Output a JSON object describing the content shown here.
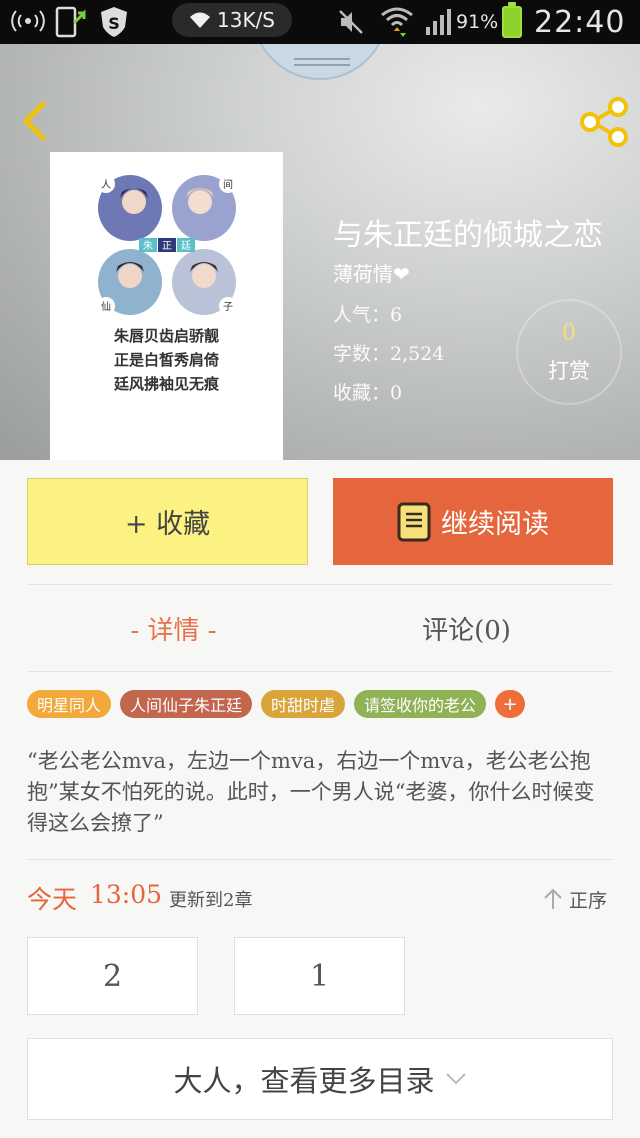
{
  "status_bar": {
    "speed": "13K/S",
    "battery_percent": "91%",
    "time": "22:40"
  },
  "book": {
    "title": "与朱正廷的倾城之恋",
    "author": "薄荷情❤",
    "popularity": "人气：6",
    "word_count": "字数：2,524",
    "favorites": "收藏：0",
    "tip_count": "0",
    "tip_label": "打赏",
    "cover_lines": [
      "朱唇贝齿启骄靓",
      "正是白皙秀肩倚",
      "廷风拂袖见无痕"
    ],
    "cover_corner_chars": [
      "人",
      "间",
      "仙",
      "子"
    ],
    "cover_center_chars": [
      "朱",
      "正",
      "廷"
    ]
  },
  "actions": {
    "favorite_label": "+ 收藏",
    "read_label": "继续阅读"
  },
  "tabs": {
    "detail": "- 详情 -",
    "comment": "评论(0)"
  },
  "tags": [
    {
      "label": "明星同人",
      "color": "#f2a83a"
    },
    {
      "label": "人间仙子朱正廷",
      "color": "#c2674e"
    },
    {
      "label": "时甜时虐",
      "color": "#d9a43a"
    },
    {
      "label": "请签收你的老公",
      "color": "#8eb254"
    }
  ],
  "tag_add": "+",
  "synopsis": "“老公老公mva，左边一个mva，右边一个mva，老公老公抱抱”某女不怕死的说。此时，一个男人说“老婆，你什么时候变得这么会撩了”",
  "update": {
    "day": "今天",
    "time": "13:05",
    "chapter_text": "更新到2章",
    "sort_label": "正序"
  },
  "chapters": [
    "2",
    "1"
  ],
  "more_catalog": "大人，查看更多目录",
  "colors": {
    "accent": "#e5653c",
    "favorite_bg": "#fcf282",
    "status_bar": "#0b0b0b"
  }
}
